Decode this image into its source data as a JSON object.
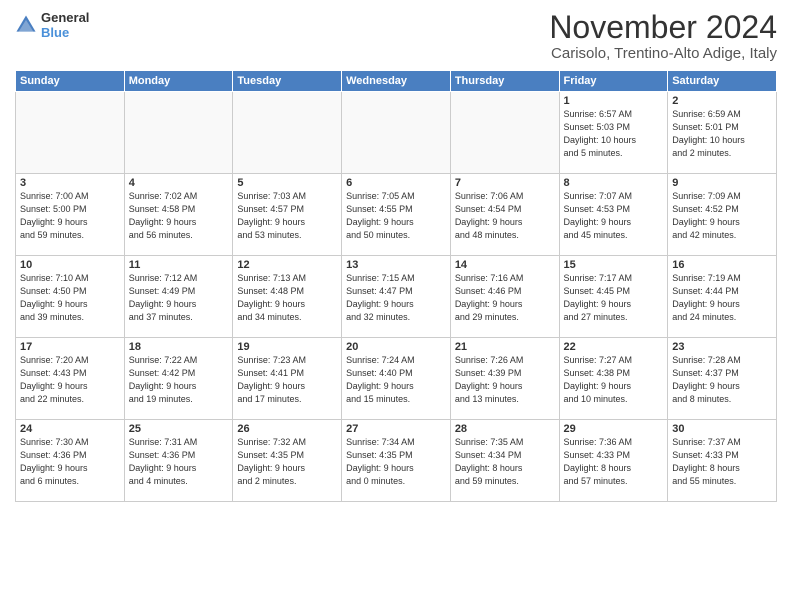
{
  "header": {
    "logo_general": "General",
    "logo_blue": "Blue",
    "month": "November 2024",
    "location": "Carisolo, Trentino-Alto Adige, Italy"
  },
  "days_of_week": [
    "Sunday",
    "Monday",
    "Tuesday",
    "Wednesday",
    "Thursday",
    "Friday",
    "Saturday"
  ],
  "weeks": [
    [
      {
        "day": "",
        "info": ""
      },
      {
        "day": "",
        "info": ""
      },
      {
        "day": "",
        "info": ""
      },
      {
        "day": "",
        "info": ""
      },
      {
        "day": "",
        "info": ""
      },
      {
        "day": "1",
        "info": "Sunrise: 6:57 AM\nSunset: 5:03 PM\nDaylight: 10 hours\nand 5 minutes."
      },
      {
        "day": "2",
        "info": "Sunrise: 6:59 AM\nSunset: 5:01 PM\nDaylight: 10 hours\nand 2 minutes."
      }
    ],
    [
      {
        "day": "3",
        "info": "Sunrise: 7:00 AM\nSunset: 5:00 PM\nDaylight: 9 hours\nand 59 minutes."
      },
      {
        "day": "4",
        "info": "Sunrise: 7:02 AM\nSunset: 4:58 PM\nDaylight: 9 hours\nand 56 minutes."
      },
      {
        "day": "5",
        "info": "Sunrise: 7:03 AM\nSunset: 4:57 PM\nDaylight: 9 hours\nand 53 minutes."
      },
      {
        "day": "6",
        "info": "Sunrise: 7:05 AM\nSunset: 4:55 PM\nDaylight: 9 hours\nand 50 minutes."
      },
      {
        "day": "7",
        "info": "Sunrise: 7:06 AM\nSunset: 4:54 PM\nDaylight: 9 hours\nand 48 minutes."
      },
      {
        "day": "8",
        "info": "Sunrise: 7:07 AM\nSunset: 4:53 PM\nDaylight: 9 hours\nand 45 minutes."
      },
      {
        "day": "9",
        "info": "Sunrise: 7:09 AM\nSunset: 4:52 PM\nDaylight: 9 hours\nand 42 minutes."
      }
    ],
    [
      {
        "day": "10",
        "info": "Sunrise: 7:10 AM\nSunset: 4:50 PM\nDaylight: 9 hours\nand 39 minutes."
      },
      {
        "day": "11",
        "info": "Sunrise: 7:12 AM\nSunset: 4:49 PM\nDaylight: 9 hours\nand 37 minutes."
      },
      {
        "day": "12",
        "info": "Sunrise: 7:13 AM\nSunset: 4:48 PM\nDaylight: 9 hours\nand 34 minutes."
      },
      {
        "day": "13",
        "info": "Sunrise: 7:15 AM\nSunset: 4:47 PM\nDaylight: 9 hours\nand 32 minutes."
      },
      {
        "day": "14",
        "info": "Sunrise: 7:16 AM\nSunset: 4:46 PM\nDaylight: 9 hours\nand 29 minutes."
      },
      {
        "day": "15",
        "info": "Sunrise: 7:17 AM\nSunset: 4:45 PM\nDaylight: 9 hours\nand 27 minutes."
      },
      {
        "day": "16",
        "info": "Sunrise: 7:19 AM\nSunset: 4:44 PM\nDaylight: 9 hours\nand 24 minutes."
      }
    ],
    [
      {
        "day": "17",
        "info": "Sunrise: 7:20 AM\nSunset: 4:43 PM\nDaylight: 9 hours\nand 22 minutes."
      },
      {
        "day": "18",
        "info": "Sunrise: 7:22 AM\nSunset: 4:42 PM\nDaylight: 9 hours\nand 19 minutes."
      },
      {
        "day": "19",
        "info": "Sunrise: 7:23 AM\nSunset: 4:41 PM\nDaylight: 9 hours\nand 17 minutes."
      },
      {
        "day": "20",
        "info": "Sunrise: 7:24 AM\nSunset: 4:40 PM\nDaylight: 9 hours\nand 15 minutes."
      },
      {
        "day": "21",
        "info": "Sunrise: 7:26 AM\nSunset: 4:39 PM\nDaylight: 9 hours\nand 13 minutes."
      },
      {
        "day": "22",
        "info": "Sunrise: 7:27 AM\nSunset: 4:38 PM\nDaylight: 9 hours\nand 10 minutes."
      },
      {
        "day": "23",
        "info": "Sunrise: 7:28 AM\nSunset: 4:37 PM\nDaylight: 9 hours\nand 8 minutes."
      }
    ],
    [
      {
        "day": "24",
        "info": "Sunrise: 7:30 AM\nSunset: 4:36 PM\nDaylight: 9 hours\nand 6 minutes."
      },
      {
        "day": "25",
        "info": "Sunrise: 7:31 AM\nSunset: 4:36 PM\nDaylight: 9 hours\nand 4 minutes."
      },
      {
        "day": "26",
        "info": "Sunrise: 7:32 AM\nSunset: 4:35 PM\nDaylight: 9 hours\nand 2 minutes."
      },
      {
        "day": "27",
        "info": "Sunrise: 7:34 AM\nSunset: 4:35 PM\nDaylight: 9 hours\nand 0 minutes."
      },
      {
        "day": "28",
        "info": "Sunrise: 7:35 AM\nSunset: 4:34 PM\nDaylight: 8 hours\nand 59 minutes."
      },
      {
        "day": "29",
        "info": "Sunrise: 7:36 AM\nSunset: 4:33 PM\nDaylight: 8 hours\nand 57 minutes."
      },
      {
        "day": "30",
        "info": "Sunrise: 7:37 AM\nSunset: 4:33 PM\nDaylight: 8 hours\nand 55 minutes."
      }
    ]
  ]
}
